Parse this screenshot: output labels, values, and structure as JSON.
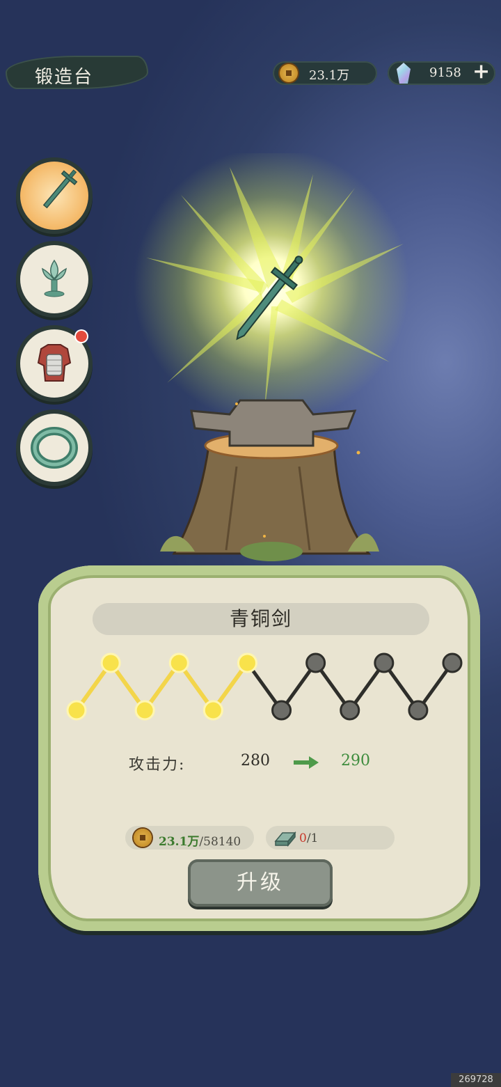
{
  "header": {
    "title": "锻造台",
    "coins": "23.1万",
    "gems": "9158",
    "add_label": "+"
  },
  "side_menu": [
    {
      "icon": "sword-icon",
      "active": true
    },
    {
      "icon": "lotus-lamp-icon",
      "active": false
    },
    {
      "icon": "armor-icon",
      "active": false,
      "notification": true
    },
    {
      "icon": "jade-bracelet-icon",
      "active": false
    }
  ],
  "item": {
    "name": "青铜剑",
    "stat_label": "攻击力:",
    "stat_current": "280",
    "stat_next": "290",
    "progress": {
      "lit": 6,
      "total": 12
    }
  },
  "cost": {
    "coin_have": "23.1万",
    "coin_need": "/58140",
    "material_have": "0",
    "material_need": "/1"
  },
  "upgrade_label": "升级",
  "watermark": "269728",
  "colors": {
    "accent_green": "#3e8c3d",
    "warning_red": "#c7382b",
    "gold": "#f5d74a"
  }
}
